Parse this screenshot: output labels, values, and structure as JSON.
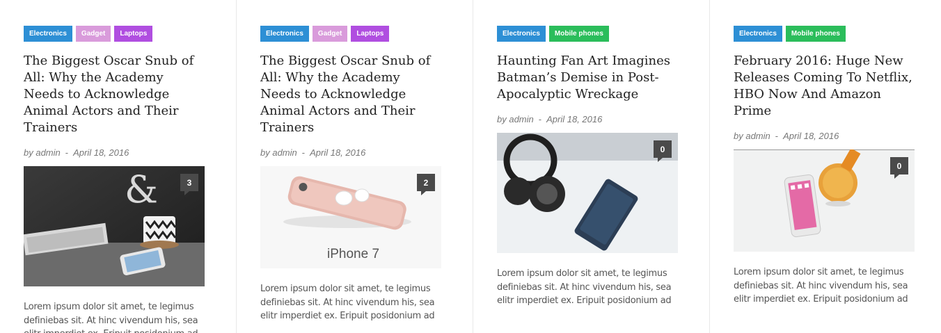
{
  "posts": [
    {
      "tags": [
        {
          "label": "Electronics",
          "color": "#2d8fd5"
        },
        {
          "label": "Gadget",
          "color": "#d99bdb"
        },
        {
          "label": "Laptops",
          "color": "#b04ee0"
        }
      ],
      "title": "The Biggest Oscar Snub of All: Why the Academy Needs to Acknowledge Animal Actors and Their Trainers",
      "author": "by admin",
      "separator": "-",
      "date": "April 18, 2016",
      "comments": "3",
      "image_label": "",
      "excerpt": "Lorem ipsum dolor sit amet, te legimus definiebas sit. At hinc vivendum his, sea elitr imperdiet ex. Eripuit posidonium ad"
    },
    {
      "tags": [
        {
          "label": "Electronics",
          "color": "#2d8fd5"
        },
        {
          "label": "Gadget",
          "color": "#d99bdb"
        },
        {
          "label": "Laptops",
          "color": "#b04ee0"
        }
      ],
      "title": "The Biggest Oscar Snub of All: Why the Academy Needs to Acknowledge Animal Actors and Their Trainers",
      "author": "by admin",
      "separator": "-",
      "date": "April 18, 2016",
      "comments": "2",
      "image_label": "iPhone 7",
      "excerpt": "Lorem ipsum dolor sit amet, te legimus definiebas sit. At hinc vivendum his, sea elitr imperdiet ex. Eripuit posidonium ad"
    },
    {
      "tags": [
        {
          "label": "Electronics",
          "color": "#2d8fd5"
        },
        {
          "label": "Mobile phones",
          "color": "#2bbd5b"
        }
      ],
      "title": "Haunting Fan Art Imagines Batman’s Demise in Post-Apocalyptic Wreckage",
      "author": "by admin",
      "separator": "-",
      "date": "April 18, 2016",
      "comments": "0",
      "image_label": "",
      "excerpt": "Lorem ipsum dolor sit amet, te legimus definiebas sit. At hinc vivendum his, sea elitr imperdiet ex. Eripuit posidonium ad"
    },
    {
      "tags": [
        {
          "label": "Electronics",
          "color": "#2d8fd5"
        },
        {
          "label": "Mobile phones",
          "color": "#2bbd5b"
        }
      ],
      "title": "February 2016: Huge New Releases Coming To Netflix, HBO Now And Amazon Prime",
      "author": "by admin",
      "separator": "-",
      "date": "April 18, 2016",
      "comments": "0",
      "image_label": "",
      "excerpt": "Lorem ipsum dolor sit amet, te legimus definiebas sit. At hinc vivendum his, sea elitr imperdiet ex. Eripuit posidonium ad"
    }
  ]
}
